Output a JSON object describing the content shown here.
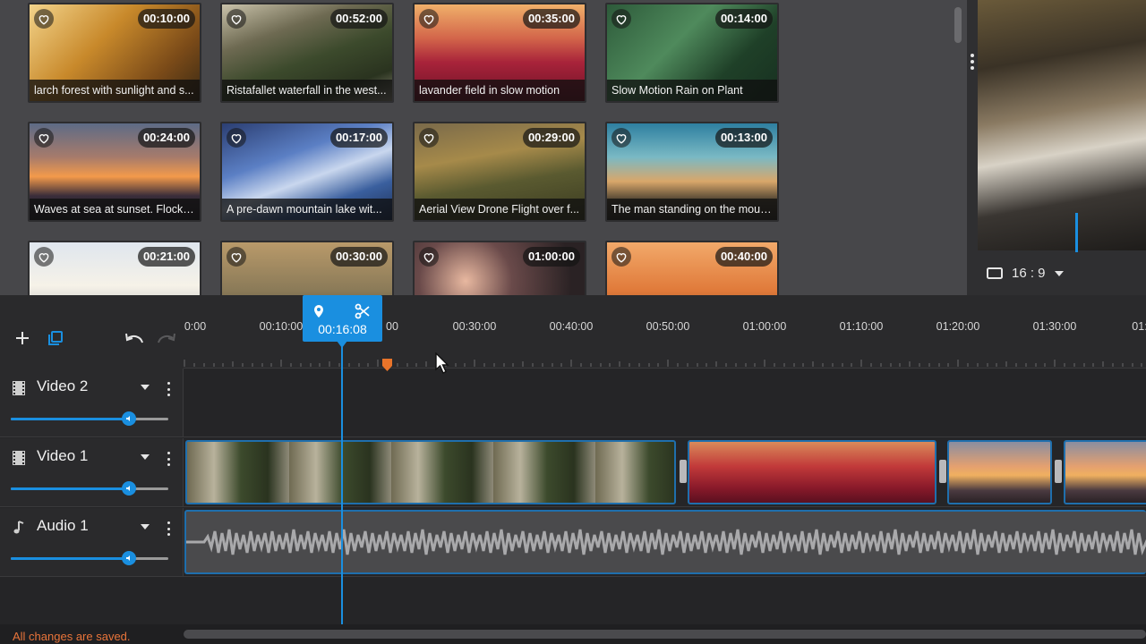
{
  "library": {
    "clips": [
      {
        "duration": "00:10:00",
        "title": "larch forest with sunlight and s..."
      },
      {
        "duration": "00:52:00",
        "title": "Ristafallet waterfall in the west..."
      },
      {
        "duration": "00:35:00",
        "title": "lavander field in slow motion"
      },
      {
        "duration": "00:14:00",
        "title": "Slow Motion Rain on Plant"
      },
      {
        "duration": "00:24:00",
        "title": "Waves at sea at sunset. Flocks ..."
      },
      {
        "duration": "00:17:00",
        "title": "A pre-dawn mountain lake wit..."
      },
      {
        "duration": "00:29:00",
        "title": "Aerial View Drone Flight over f..."
      },
      {
        "duration": "00:13:00",
        "title": "The man standing on the moun..."
      },
      {
        "duration": "00:21:00",
        "title": ""
      },
      {
        "duration": "00:30:00",
        "title": ""
      },
      {
        "duration": "01:00:00",
        "title": ""
      },
      {
        "duration": "00:40:00",
        "title": ""
      }
    ]
  },
  "preview": {
    "aspect_ratio": "16 : 9"
  },
  "timeline": {
    "ruler_labels": [
      "0:00",
      "00:10:00",
      "00",
      "00:30:00",
      "00:40:00",
      "00:50:00",
      "01:00:00",
      "01:10:00",
      "01:20:00",
      "01:30:00",
      "01:"
    ],
    "playhead_time": "00:16:08",
    "tracks": [
      {
        "name": "Video 2",
        "volume": 0.77
      },
      {
        "name": "Video 1",
        "volume": 0.77
      },
      {
        "name": "Audio 1",
        "volume": 0.77
      }
    ]
  },
  "status": {
    "message": "All changes are saved."
  },
  "colors": {
    "accent": "#1a8fe0",
    "marker": "#e8742a",
    "status": "#e8743a"
  }
}
